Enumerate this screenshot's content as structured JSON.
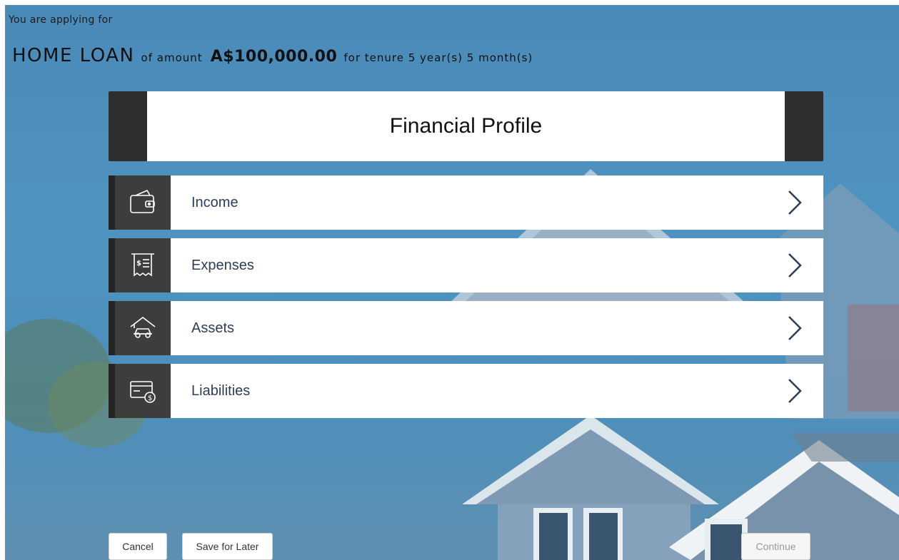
{
  "header": {
    "intro": "You are applying for",
    "product": "HOME LOAN",
    "of_amount": "of amount",
    "amount": "A$100,000.00",
    "for_tenure": "for tenure 5 year(s) 5 month(s)"
  },
  "card": {
    "title": "Financial Profile"
  },
  "sections": [
    {
      "label": "Income",
      "icon": "wallet-icon"
    },
    {
      "label": "Expenses",
      "icon": "receipt-icon"
    },
    {
      "label": "Assets",
      "icon": "house-car-icon"
    },
    {
      "label": "Liabilities",
      "icon": "card-dollar-icon"
    }
  ],
  "footer": {
    "cancel_label": "Cancel",
    "save_label": "Save for Later",
    "continue_label": "Continue"
  },
  "colors": {
    "sky": "#4a8ab8",
    "icon_panel": "#3d3d3d",
    "title_bar_edge": "#2e2e2e",
    "row_text": "#2c3e57"
  }
}
